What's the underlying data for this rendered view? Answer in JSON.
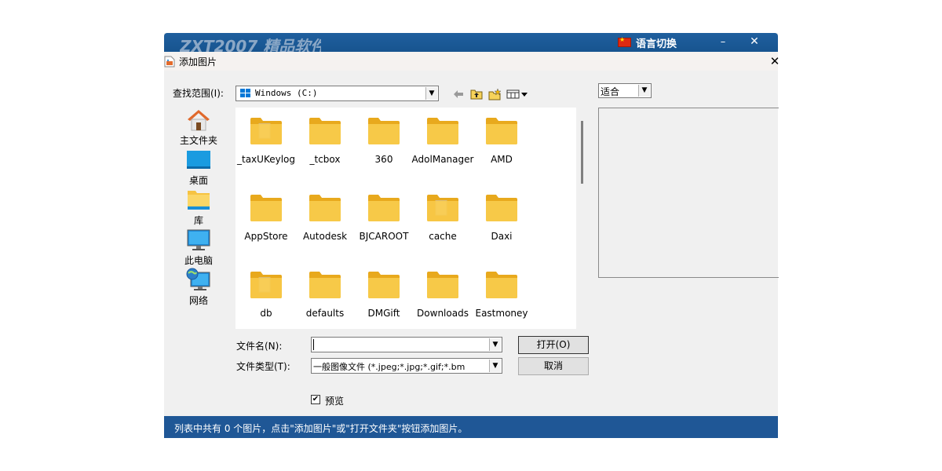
{
  "background_window": {
    "title": "ZXT2007 精品软件",
    "language_switch": "语言切换",
    "min_glyph": "–",
    "close_glyph": "✕"
  },
  "dialog": {
    "title": "添加图片",
    "close_glyph": "✕"
  },
  "lookin": {
    "label": "查找范围(I):",
    "value": "Windows (C:)"
  },
  "toolbar": {
    "back_icon": "back-arrow-icon",
    "up_folder_icon": "up-folder-icon",
    "new_folder_icon": "new-folder-icon",
    "view_menu_icon": "view-menu-icon"
  },
  "places": [
    {
      "label": "主文件夹",
      "icon": "home-icon"
    },
    {
      "label": "桌面",
      "icon": "desktop-icon"
    },
    {
      "label": "库",
      "icon": "library-icon"
    },
    {
      "label": "此电脑",
      "icon": "computer-icon"
    },
    {
      "label": "网络",
      "icon": "network-icon"
    }
  ],
  "files": [
    {
      "name": "_taxUKeylog",
      "has_doc": true
    },
    {
      "name": "_tcbox",
      "has_doc": false
    },
    {
      "name": "360",
      "has_doc": false
    },
    {
      "name": "AdolManager",
      "has_doc": false
    },
    {
      "name": "AMD",
      "has_doc": false
    },
    {
      "name": "AppStore",
      "has_doc": false
    },
    {
      "name": "Autodesk",
      "has_doc": false
    },
    {
      "name": "BJCAROOT",
      "has_doc": false
    },
    {
      "name": "cache",
      "has_doc": true
    },
    {
      "name": "Daxi",
      "has_doc": false
    },
    {
      "name": "db",
      "has_doc": true
    },
    {
      "name": "defaults",
      "has_doc": false
    },
    {
      "name": "DMGift",
      "has_doc": false
    },
    {
      "name": "Downloads",
      "has_doc": false
    },
    {
      "name": "Eastmoney",
      "has_doc": false
    }
  ],
  "filename": {
    "label": "文件名(N):",
    "value": ""
  },
  "filetype": {
    "label": "文件类型(T):",
    "value": "一般图像文件 (*.jpeg;*.jpg;*.gif;*.bm"
  },
  "buttons": {
    "open": "打开(O)",
    "cancel": "取消"
  },
  "preview": {
    "label": "预览",
    "checked": true,
    "check_glyph": "✔"
  },
  "fit": {
    "value": "适合"
  },
  "status": {
    "text": "列表中共有 0 个图片，点击\"添加图片\"或\"打开文件夹\"按钮添加图片。"
  },
  "colors": {
    "titlebar": "#1f5f9e",
    "statusbar": "#1f5796",
    "folder": "#f7c948",
    "folder_dark": "#e8a91d"
  }
}
